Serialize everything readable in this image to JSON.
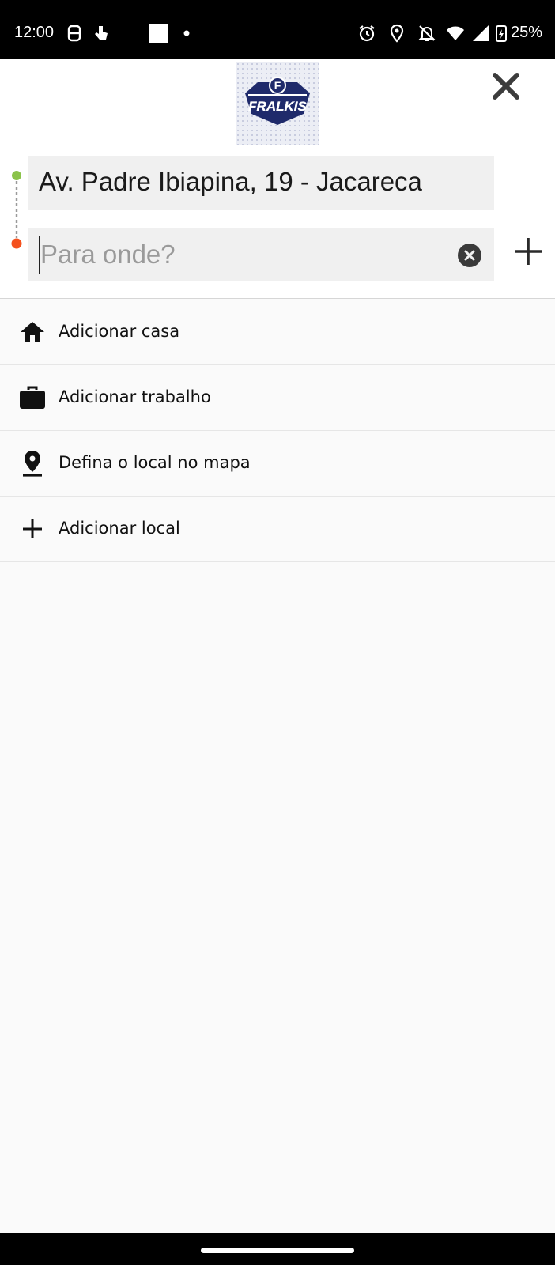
{
  "status_bar": {
    "time": "12:00",
    "battery": "25%",
    "icons": [
      "sim-icon",
      "touch-icon",
      "square-icon",
      "dot-icon",
      "alarm-icon",
      "location-icon",
      "bell-off-icon",
      "wifi-icon",
      "signal-icon",
      "battery-icon"
    ]
  },
  "header": {
    "logo_text": "FRALKIS",
    "logo_letter": "F",
    "origin": "Av. Padre Ibiapina, 19 - Jacareca",
    "destination_placeholder": "Para onde?",
    "destination_value": ""
  },
  "list": {
    "items": [
      {
        "label": "Adicionar casa",
        "icon": "home-icon"
      },
      {
        "label": "Adicionar trabalho",
        "icon": "briefcase-icon"
      },
      {
        "label": "Defina o local no mapa",
        "icon": "map-pin-icon"
      },
      {
        "label": "Adicionar local",
        "icon": "plus-icon"
      }
    ]
  },
  "colors": {
    "origin_dot": "#8bc34a",
    "destination_dot": "#f4511e",
    "logo_navy": "#1f2a6b"
  }
}
